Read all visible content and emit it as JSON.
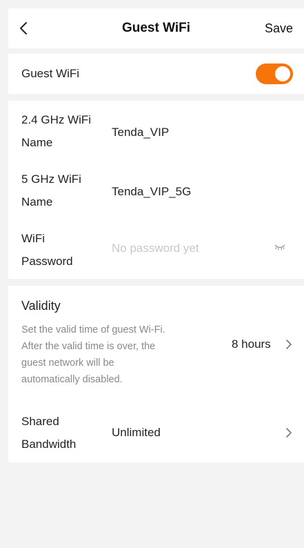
{
  "header": {
    "title": "Guest WiFi",
    "save_label": "Save"
  },
  "guest_toggle": {
    "label": "Guest WiFi",
    "enabled": true,
    "accent_color": "#f7740b"
  },
  "wifi": {
    "name_24_label_line1": "2.4 GHz WiFi",
    "name_24_label_line2": "Name",
    "name_24_value": "Tenda_VIP",
    "name_5_label_line1": "5 GHz WiFi",
    "name_5_label_line2": "Name",
    "name_5_value": "Tenda_VIP_5G",
    "password_label_line1": "WiFi",
    "password_label_line2": "Password",
    "password_placeholder": "No password yet"
  },
  "validity": {
    "label": "Validity",
    "description_line1": "Set the valid time of guest Wi-Fi.",
    "description_line2": "After the valid time is over, the",
    "description_line3": "guest network will be",
    "description_line4": "automatically disabled.",
    "value": "8 hours"
  },
  "bandwidth": {
    "label_line1": "Shared",
    "label_line2": "Bandwidth",
    "value": "Unlimited"
  },
  "icons": {
    "back": "chevron-left-icon",
    "password_visibility": "eye-closed-icon",
    "chevron": "chevron-right-icon"
  }
}
